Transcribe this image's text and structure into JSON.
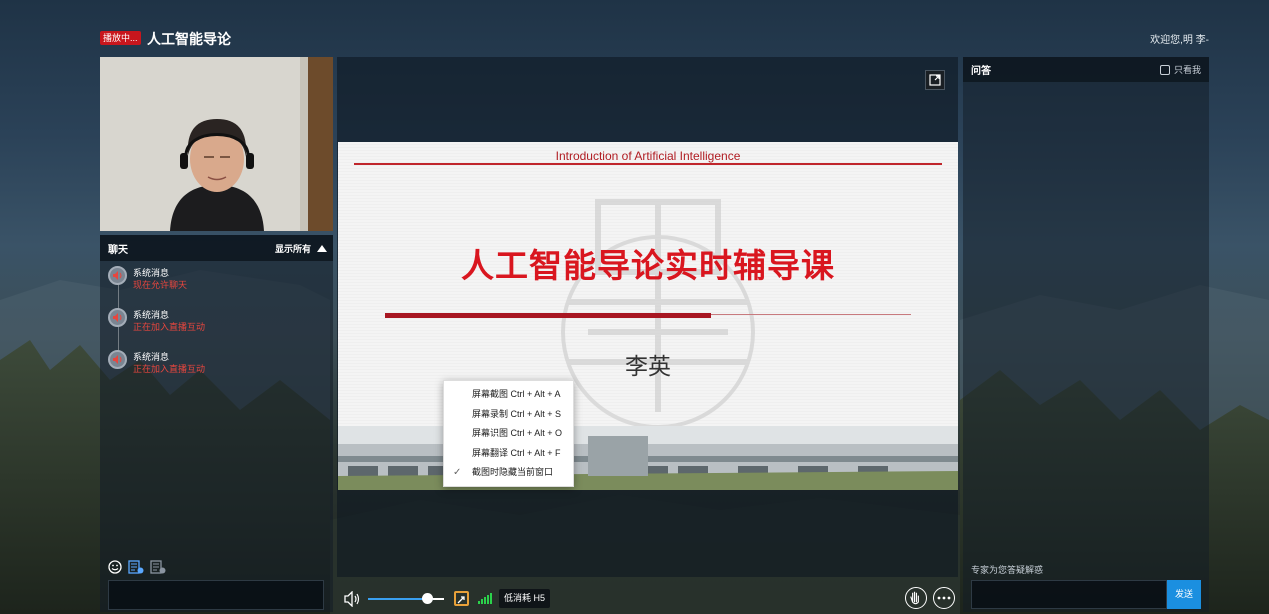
{
  "header": {
    "status_badge": "播放中...",
    "course_title": "人工智能导论",
    "welcome": "欢迎您,明 李-"
  },
  "chat": {
    "title": "聊天",
    "filter_label": "显示所有",
    "messages": [
      {
        "sender": "系统消息",
        "text": "现在允许聊天"
      },
      {
        "sender": "系统消息",
        "text": "正在加入直播互动"
      },
      {
        "sender": "系统消息",
        "text": "正在加入直播互动"
      }
    ],
    "tools": [
      "emoji-icon",
      "doc-icon",
      "doc-icon-2"
    ]
  },
  "slide": {
    "header": "Introduction of Artificial Intelligence",
    "title": "人工智能导论实时辅导课",
    "author": "李英"
  },
  "context_menu": {
    "items": [
      {
        "label": "屏幕截图 Ctrl + Alt + A",
        "checked": false
      },
      {
        "label": "屏幕录制 Ctrl + Alt + S",
        "checked": false
      },
      {
        "label": "屏幕识图 Ctrl + Alt + O",
        "checked": false
      },
      {
        "label": "屏幕翻译 Ctrl + Alt + F",
        "checked": false
      },
      {
        "label": "截图时隐藏当前窗口",
        "checked": true
      }
    ]
  },
  "player": {
    "volume_level": 0.75,
    "low_power_label": "低消耗 H5"
  },
  "qa": {
    "title": "问答",
    "only_me_label": "只看我",
    "hint": "专家为您答疑解惑",
    "send_label": "发送"
  },
  "colors": {
    "accent": "#1b8fe0",
    "live_red": "#c8161d",
    "message_red": "#e8463e",
    "slide_red": "#d9161f"
  }
}
